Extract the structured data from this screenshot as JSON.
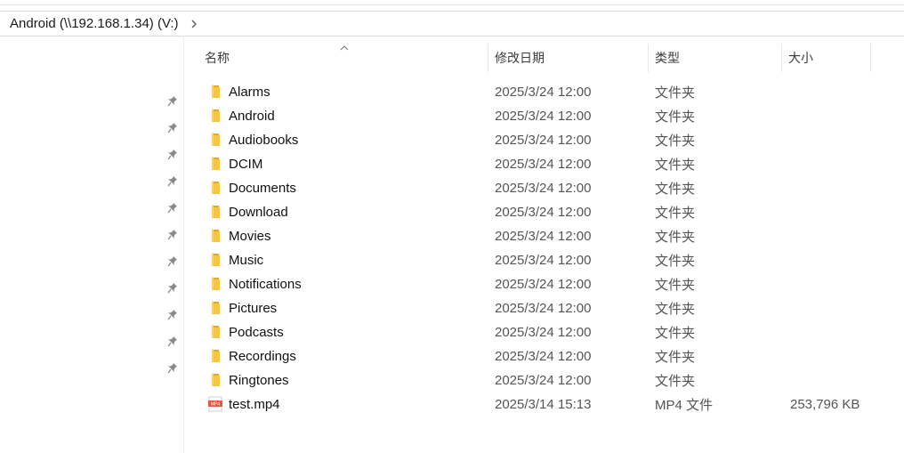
{
  "address": {
    "path": "Android (\\\\192.168.1.34) (V:)",
    "chevron_icon": "chevron-right-icon"
  },
  "columns": {
    "name": "名称",
    "date": "修改日期",
    "type": "类型",
    "size": "大小",
    "sort_icon": "sort-up-icon"
  },
  "pinned_count": 11,
  "colors": {
    "folder": "#F4C548",
    "folder_dark": "#E3A920",
    "video_icon": "#E8573A"
  },
  "files": [
    {
      "name": "Alarms",
      "date": "2025/3/24 12:00",
      "type": "文件夹",
      "size": "",
      "icon": "folder-icon"
    },
    {
      "name": "Android",
      "date": "2025/3/24 12:00",
      "type": "文件夹",
      "size": "",
      "icon": "folder-icon"
    },
    {
      "name": "Audiobooks",
      "date": "2025/3/24 12:00",
      "type": "文件夹",
      "size": "",
      "icon": "folder-icon"
    },
    {
      "name": "DCIM",
      "date": "2025/3/24 12:00",
      "type": "文件夹",
      "size": "",
      "icon": "folder-icon"
    },
    {
      "name": "Documents",
      "date": "2025/3/24 12:00",
      "type": "文件夹",
      "size": "",
      "icon": "folder-icon"
    },
    {
      "name": "Download",
      "date": "2025/3/24 12:00",
      "type": "文件夹",
      "size": "",
      "icon": "folder-icon"
    },
    {
      "name": "Movies",
      "date": "2025/3/24 12:00",
      "type": "文件夹",
      "size": "",
      "icon": "folder-icon"
    },
    {
      "name": "Music",
      "date": "2025/3/24 12:00",
      "type": "文件夹",
      "size": "",
      "icon": "folder-icon"
    },
    {
      "name": "Notifications",
      "date": "2025/3/24 12:00",
      "type": "文件夹",
      "size": "",
      "icon": "folder-icon"
    },
    {
      "name": "Pictures",
      "date": "2025/3/24 12:00",
      "type": "文件夹",
      "size": "",
      "icon": "folder-icon"
    },
    {
      "name": "Podcasts",
      "date": "2025/3/24 12:00",
      "type": "文件夹",
      "size": "",
      "icon": "folder-icon"
    },
    {
      "name": "Recordings",
      "date": "2025/3/24 12:00",
      "type": "文件夹",
      "size": "",
      "icon": "folder-icon"
    },
    {
      "name": "Ringtones",
      "date": "2025/3/24 12:00",
      "type": "文件夹",
      "size": "",
      "icon": "folder-icon"
    },
    {
      "name": "test.mp4",
      "date": "2025/3/14 15:13",
      "type": "MP4 文件",
      "size": "253,796 KB",
      "icon": "mp4-file-icon",
      "icon_text": "MP4"
    }
  ]
}
